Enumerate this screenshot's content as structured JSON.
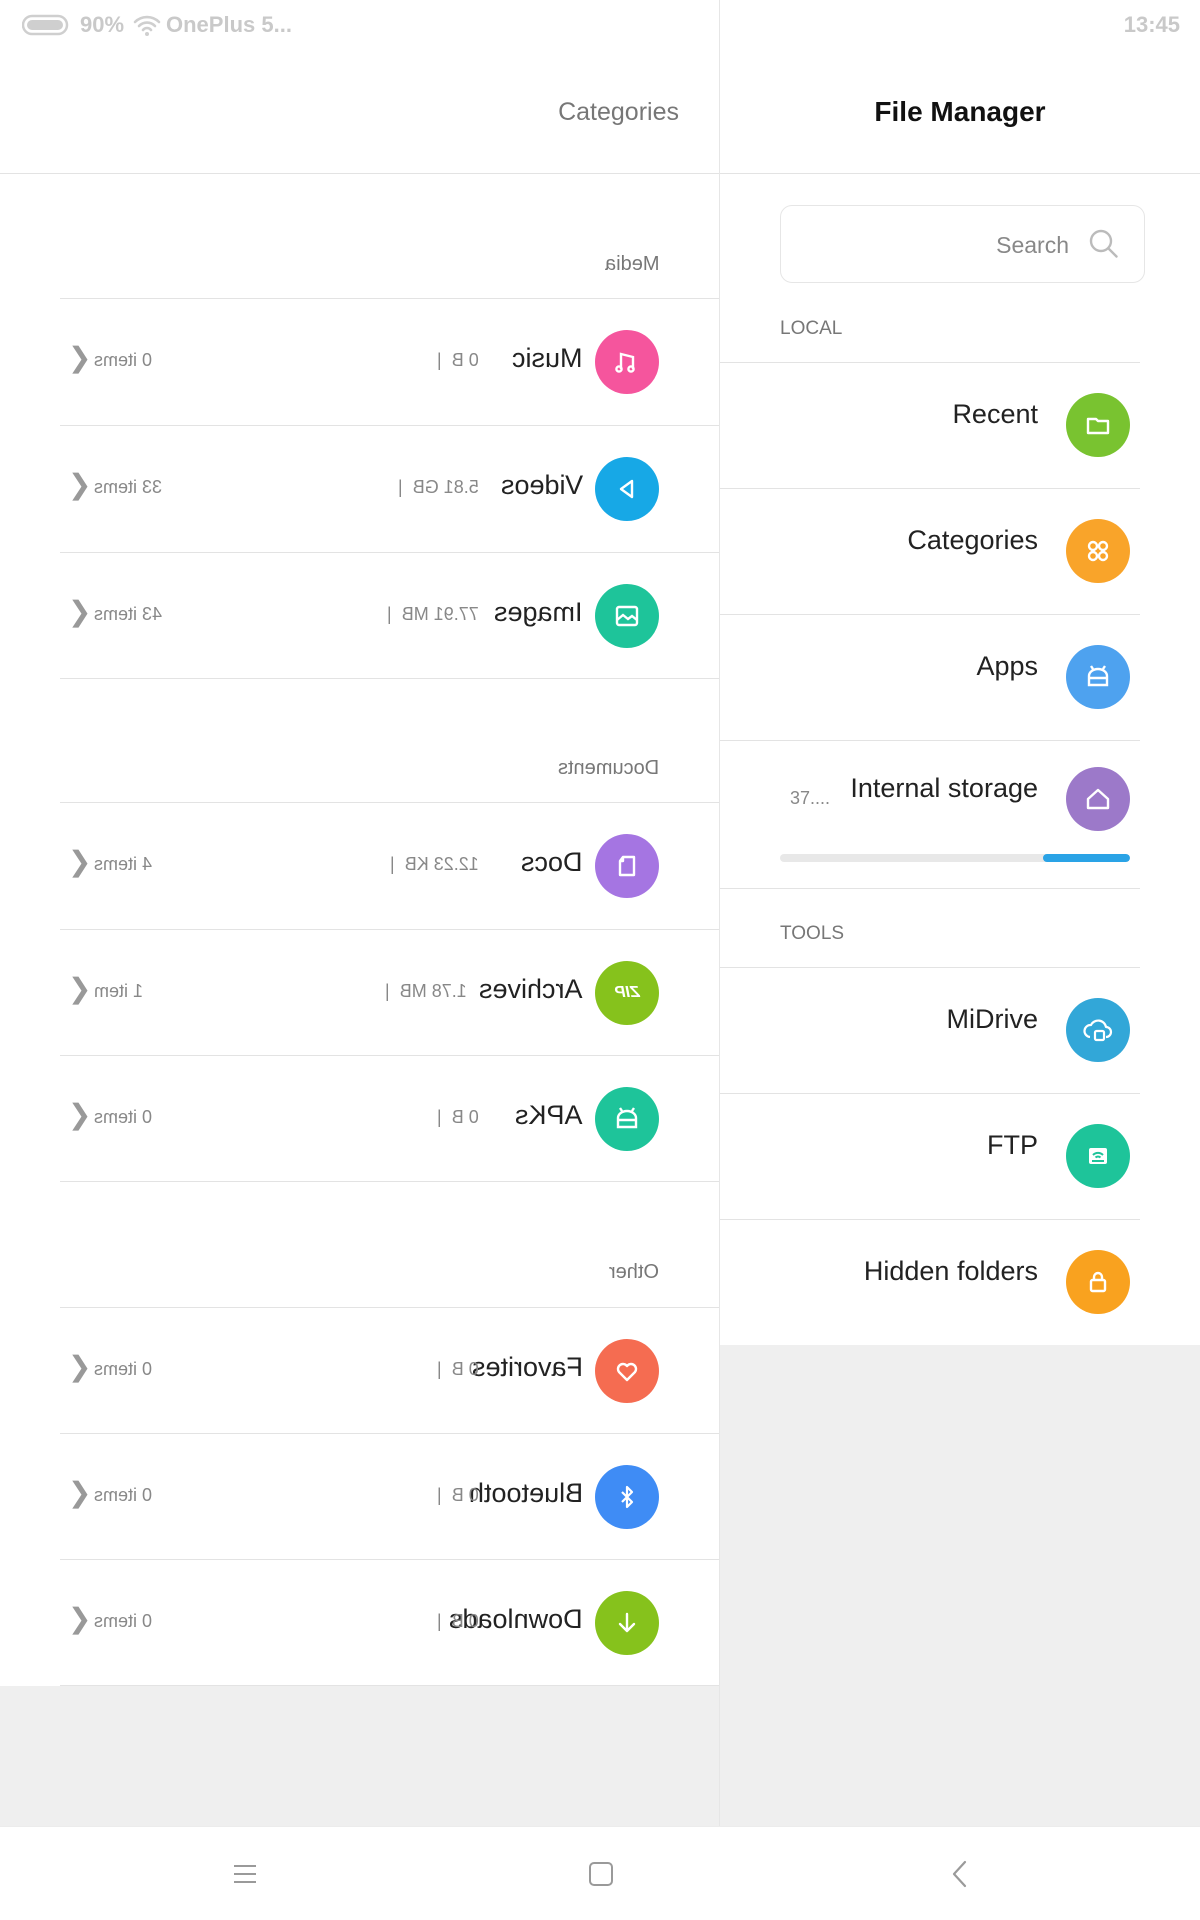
{
  "status_bar": {
    "battery": "90%",
    "network": "OnePlus 5...",
    "time": "13:45"
  },
  "left_panel": {
    "title": "Categories",
    "sections": [
      {
        "label": "Media",
        "items": [
          {
            "name": "Music",
            "size": "0 B",
            "count": "0 items",
            "color": "#f5559d",
            "icon": "music-note-icon"
          },
          {
            "name": "Videos",
            "size": "5.81 GB",
            "count": "33 items",
            "color": "#17a8e6",
            "icon": "play-icon"
          },
          {
            "name": "Images",
            "size": "77.91 MB",
            "count": "43 items",
            "color": "#1ec49a",
            "icon": "image-icon"
          }
        ]
      },
      {
        "label": "Documents",
        "items": [
          {
            "name": "Docs",
            "size": "12.23 KB",
            "count": "4 items",
            "color": "#a575e2",
            "icon": "document-icon"
          },
          {
            "name": "Archives",
            "size": "1.78 MB",
            "count": "1 item",
            "color": "#86c21c",
            "icon": "zip-icon",
            "icon_text": "ZIP"
          },
          {
            "name": "APKs",
            "size": "0 B",
            "count": "0 items",
            "color": "#1ec49a",
            "icon": "android-icon"
          }
        ]
      },
      {
        "label": "Other",
        "items": [
          {
            "name": "Favorites",
            "size": "0 B",
            "count": "0 items",
            "color": "#f56c51",
            "icon": "heart-icon"
          },
          {
            "name": "Bluetooth",
            "size": "0 B",
            "count": "0 items",
            "color": "#3f8cf5",
            "icon": "bluetooth-icon"
          },
          {
            "name": "Downloads",
            "size": "0 B",
            "count": "0 items",
            "color": "#86c21c",
            "icon": "download-icon"
          }
        ]
      }
    ]
  },
  "right_panel": {
    "title": "File Manager",
    "search": {
      "placeholder": "Search"
    },
    "local_label": "LOCAL",
    "local_items": [
      {
        "label": "Recent",
        "color": "#79c330",
        "icon": "folder-icon"
      },
      {
        "label": "Categories",
        "color": "#f9a42a",
        "icon": "grid-icon"
      },
      {
        "label": "Apps",
        "color": "#4ea2ef",
        "icon": "android-icon"
      }
    ],
    "storage": {
      "label": "Internal storage",
      "free": "37....",
      "used_fraction": 0.25,
      "color": "#9c79c9",
      "icon": "home-icon"
    },
    "tools_label": "TOOLS",
    "tools_items": [
      {
        "label": "MiDrive",
        "color": "#32a7d8",
        "icon": "cloud-icon"
      },
      {
        "label": "FTP",
        "color": "#1ec49a",
        "icon": "ftp-icon"
      },
      {
        "label": "Hidden folders",
        "color": "#f9a21f",
        "icon": "lock-icon"
      }
    ]
  },
  "nav_bar": {
    "menu": "menu-icon",
    "home": "home-square-icon",
    "back": "back-icon"
  }
}
